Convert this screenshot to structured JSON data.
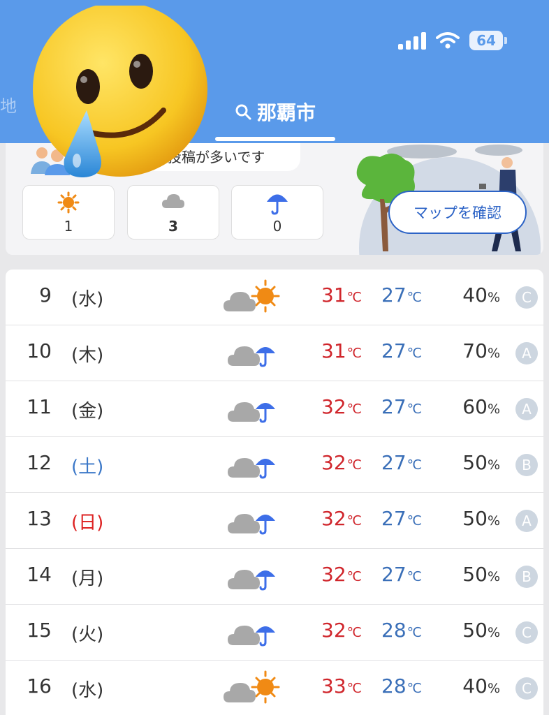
{
  "status": {
    "battery": "64"
  },
  "header": {
    "side_char": "地",
    "location": "那覇市"
  },
  "top_card": {
    "post_text": "投稿が多いです",
    "counts": [
      {
        "icon": "sun-icon",
        "value": "1",
        "bold": false
      },
      {
        "icon": "cloud-icon",
        "value": "3",
        "bold": true
      },
      {
        "icon": "umbrella-icon",
        "value": "0",
        "bold": false
      }
    ],
    "map_button": "マップを確認"
  },
  "forecast": {
    "temp_unit": "℃",
    "rain_unit": "%",
    "rows": [
      {
        "day": "9",
        "dow": "(水)",
        "dow_type": "weekday",
        "weather": "cloud-sun-icon",
        "hi": "31",
        "lo": "27",
        "rain": "40",
        "rank": "C"
      },
      {
        "day": "10",
        "dow": "(木)",
        "dow_type": "weekday",
        "weather": "cloud-rain-icon",
        "hi": "31",
        "lo": "27",
        "rain": "70",
        "rank": "A"
      },
      {
        "day": "11",
        "dow": "(金)",
        "dow_type": "weekday",
        "weather": "cloud-rain-icon",
        "hi": "32",
        "lo": "27",
        "rain": "60",
        "rank": "A"
      },
      {
        "day": "12",
        "dow": "(土)",
        "dow_type": "sat",
        "weather": "cloud-rain-icon",
        "hi": "32",
        "lo": "27",
        "rain": "50",
        "rank": "B"
      },
      {
        "day": "13",
        "dow": "(日)",
        "dow_type": "sun",
        "weather": "cloud-rain-icon",
        "hi": "32",
        "lo": "27",
        "rain": "50",
        "rank": "A"
      },
      {
        "day": "14",
        "dow": "(月)",
        "dow_type": "weekday",
        "weather": "cloud-rain-icon",
        "hi": "32",
        "lo": "27",
        "rain": "50",
        "rank": "B"
      },
      {
        "day": "15",
        "dow": "(火)",
        "dow_type": "weekday",
        "weather": "cloud-rain-icon",
        "hi": "32",
        "lo": "28",
        "rain": "50",
        "rank": "C"
      },
      {
        "day": "16",
        "dow": "(水)",
        "dow_type": "weekday",
        "weather": "cloud-sun-icon",
        "hi": "33",
        "lo": "28",
        "rain": "40",
        "rank": "C"
      }
    ]
  },
  "colors": {
    "header": "#5a9aea",
    "high_temp": "#d0262c",
    "low_temp": "#3a6fb8",
    "saturday": "#3c78c8",
    "sunday": "#dd2222"
  }
}
